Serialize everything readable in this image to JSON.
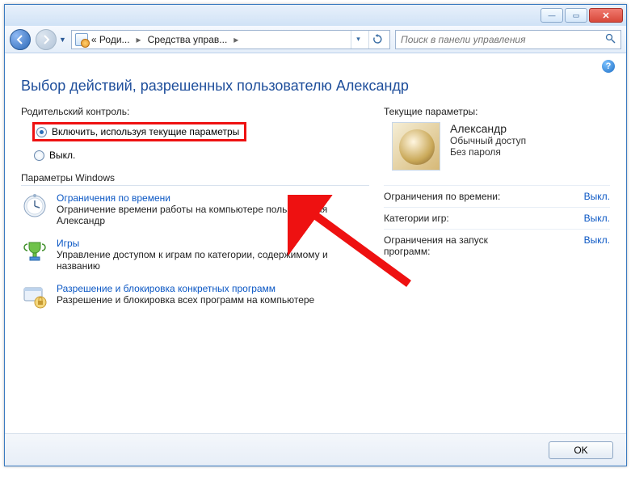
{
  "breadcrumb": {
    "root": "« Роди...",
    "page": "Средства управ..."
  },
  "search": {
    "placeholder": "Поиск в панели управления"
  },
  "page_title": "Выбор действий, разрешенных пользователю Александр",
  "pc": {
    "section_label": "Родительский контроль:",
    "on_label": "Включить, используя текущие параметры",
    "off_label": "Выкл."
  },
  "current_settings_label": "Текущие параметры:",
  "params_windows_label": "Параметры Windows",
  "items": {
    "time": {
      "title": "Ограничения по времени",
      "desc": "Ограничение времени работы на компьютере пользователя Александр"
    },
    "games": {
      "title": "Игры",
      "desc": "Управление доступом к играм по категории, содержимому и названию"
    },
    "programs": {
      "title": "Разрешение и блокировка конкретных программ",
      "desc": "Разрешение и блокировка всех программ на компьютере"
    }
  },
  "user": {
    "name": "Александр",
    "type": "Обычный доступ",
    "password": "Без пароля"
  },
  "status": {
    "time_label": "Ограничения по времени:",
    "games_label": "Категории игр:",
    "programs_label": "Ограничения на запуск программ:",
    "time_value": "Выкл.",
    "games_value": "Выкл.",
    "programs_value": "Выкл."
  },
  "ok_label": "OK"
}
